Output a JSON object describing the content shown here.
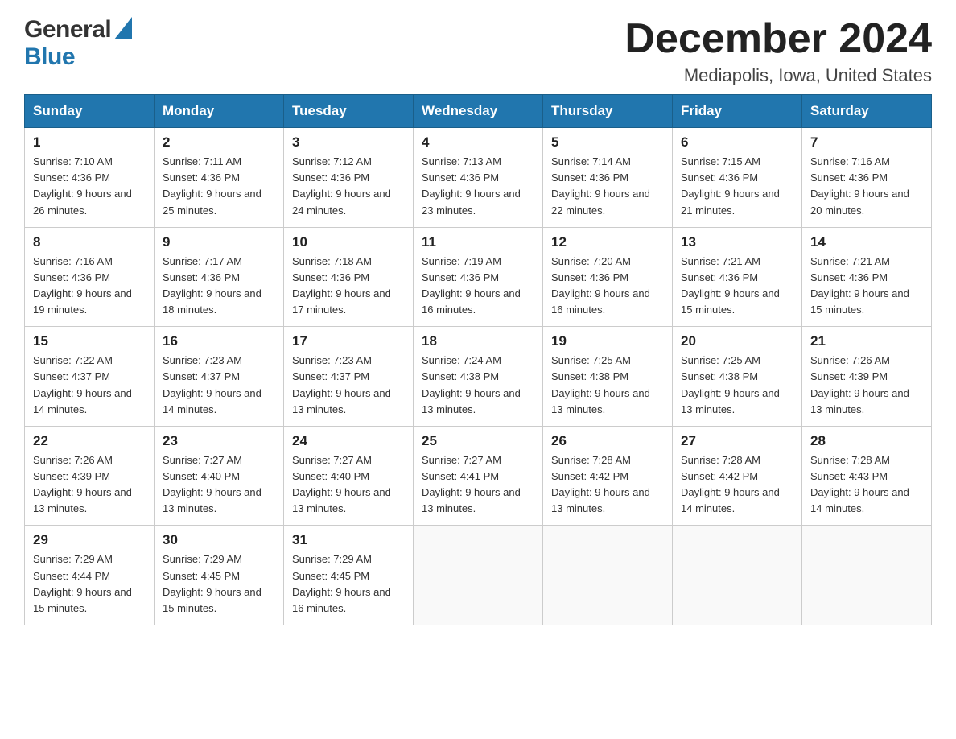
{
  "logo": {
    "general": "General",
    "blue": "Blue"
  },
  "title": "December 2024",
  "subtitle": "Mediapolis, Iowa, United States",
  "days_of_week": [
    "Sunday",
    "Monday",
    "Tuesday",
    "Wednesday",
    "Thursday",
    "Friday",
    "Saturday"
  ],
  "weeks": [
    [
      {
        "day": 1,
        "sunrise": "7:10 AM",
        "sunset": "4:36 PM",
        "daylight": "9 hours and 26 minutes."
      },
      {
        "day": 2,
        "sunrise": "7:11 AM",
        "sunset": "4:36 PM",
        "daylight": "9 hours and 25 minutes."
      },
      {
        "day": 3,
        "sunrise": "7:12 AM",
        "sunset": "4:36 PM",
        "daylight": "9 hours and 24 minutes."
      },
      {
        "day": 4,
        "sunrise": "7:13 AM",
        "sunset": "4:36 PM",
        "daylight": "9 hours and 23 minutes."
      },
      {
        "day": 5,
        "sunrise": "7:14 AM",
        "sunset": "4:36 PM",
        "daylight": "9 hours and 22 minutes."
      },
      {
        "day": 6,
        "sunrise": "7:15 AM",
        "sunset": "4:36 PM",
        "daylight": "9 hours and 21 minutes."
      },
      {
        "day": 7,
        "sunrise": "7:16 AM",
        "sunset": "4:36 PM",
        "daylight": "9 hours and 20 minutes."
      }
    ],
    [
      {
        "day": 8,
        "sunrise": "7:16 AM",
        "sunset": "4:36 PM",
        "daylight": "9 hours and 19 minutes."
      },
      {
        "day": 9,
        "sunrise": "7:17 AM",
        "sunset": "4:36 PM",
        "daylight": "9 hours and 18 minutes."
      },
      {
        "day": 10,
        "sunrise": "7:18 AM",
        "sunset": "4:36 PM",
        "daylight": "9 hours and 17 minutes."
      },
      {
        "day": 11,
        "sunrise": "7:19 AM",
        "sunset": "4:36 PM",
        "daylight": "9 hours and 16 minutes."
      },
      {
        "day": 12,
        "sunrise": "7:20 AM",
        "sunset": "4:36 PM",
        "daylight": "9 hours and 16 minutes."
      },
      {
        "day": 13,
        "sunrise": "7:21 AM",
        "sunset": "4:36 PM",
        "daylight": "9 hours and 15 minutes."
      },
      {
        "day": 14,
        "sunrise": "7:21 AM",
        "sunset": "4:36 PM",
        "daylight": "9 hours and 15 minutes."
      }
    ],
    [
      {
        "day": 15,
        "sunrise": "7:22 AM",
        "sunset": "4:37 PM",
        "daylight": "9 hours and 14 minutes."
      },
      {
        "day": 16,
        "sunrise": "7:23 AM",
        "sunset": "4:37 PM",
        "daylight": "9 hours and 14 minutes."
      },
      {
        "day": 17,
        "sunrise": "7:23 AM",
        "sunset": "4:37 PM",
        "daylight": "9 hours and 13 minutes."
      },
      {
        "day": 18,
        "sunrise": "7:24 AM",
        "sunset": "4:38 PM",
        "daylight": "9 hours and 13 minutes."
      },
      {
        "day": 19,
        "sunrise": "7:25 AM",
        "sunset": "4:38 PM",
        "daylight": "9 hours and 13 minutes."
      },
      {
        "day": 20,
        "sunrise": "7:25 AM",
        "sunset": "4:38 PM",
        "daylight": "9 hours and 13 minutes."
      },
      {
        "day": 21,
        "sunrise": "7:26 AM",
        "sunset": "4:39 PM",
        "daylight": "9 hours and 13 minutes."
      }
    ],
    [
      {
        "day": 22,
        "sunrise": "7:26 AM",
        "sunset": "4:39 PM",
        "daylight": "9 hours and 13 minutes."
      },
      {
        "day": 23,
        "sunrise": "7:27 AM",
        "sunset": "4:40 PM",
        "daylight": "9 hours and 13 minutes."
      },
      {
        "day": 24,
        "sunrise": "7:27 AM",
        "sunset": "4:40 PM",
        "daylight": "9 hours and 13 minutes."
      },
      {
        "day": 25,
        "sunrise": "7:27 AM",
        "sunset": "4:41 PM",
        "daylight": "9 hours and 13 minutes."
      },
      {
        "day": 26,
        "sunrise": "7:28 AM",
        "sunset": "4:42 PM",
        "daylight": "9 hours and 13 minutes."
      },
      {
        "day": 27,
        "sunrise": "7:28 AM",
        "sunset": "4:42 PM",
        "daylight": "9 hours and 14 minutes."
      },
      {
        "day": 28,
        "sunrise": "7:28 AM",
        "sunset": "4:43 PM",
        "daylight": "9 hours and 14 minutes."
      }
    ],
    [
      {
        "day": 29,
        "sunrise": "7:29 AM",
        "sunset": "4:44 PM",
        "daylight": "9 hours and 15 minutes."
      },
      {
        "day": 30,
        "sunrise": "7:29 AM",
        "sunset": "4:45 PM",
        "daylight": "9 hours and 15 minutes."
      },
      {
        "day": 31,
        "sunrise": "7:29 AM",
        "sunset": "4:45 PM",
        "daylight": "9 hours and 16 minutes."
      },
      null,
      null,
      null,
      null
    ]
  ]
}
